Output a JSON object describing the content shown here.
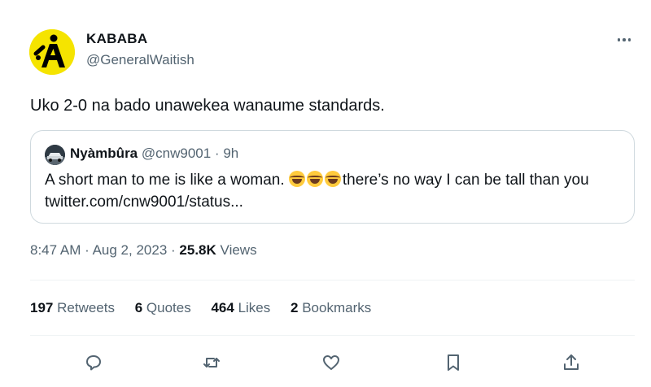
{
  "author": {
    "name": "KABABA",
    "handle": "@GeneralWaitish",
    "avatar_letter": "A"
  },
  "tweet": {
    "text": "Uko 2-0 na bado unawekea wanaume standards."
  },
  "quote": {
    "name": "Nyàmbûra",
    "handle": "@cnw9001",
    "separator": "·",
    "time": "9h",
    "text_before": "A short man to me is like a woman.",
    "emojis": [
      "tears-of-joy",
      "tears-of-joy",
      "tears-of-joy"
    ],
    "text_after": "there’s no way I can be tall than you twitter.com/cnw9001/status..."
  },
  "meta": {
    "time": "8:47 AM",
    "separator1": "·",
    "date": "Aug 2, 2023",
    "separator2": "·",
    "views_count": "25.8K",
    "views_label": "Views"
  },
  "stats": {
    "retweets_count": "197",
    "retweets_label": "Retweets",
    "quotes_count": "6",
    "quotes_label": "Quotes",
    "likes_count": "464",
    "likes_label": "Likes",
    "bookmarks_count": "2",
    "bookmarks_label": "Bookmarks"
  },
  "icons": {
    "more": "more-horizontal-icon",
    "reply": "reply-icon",
    "retweet": "retweet-icon",
    "like": "heart-icon",
    "bookmark": "bookmark-icon",
    "share": "share-icon"
  },
  "colors": {
    "text_primary": "#0f1419",
    "text_secondary": "#536471",
    "border": "#cfd9de",
    "avatar_bg": "#f5e400"
  }
}
